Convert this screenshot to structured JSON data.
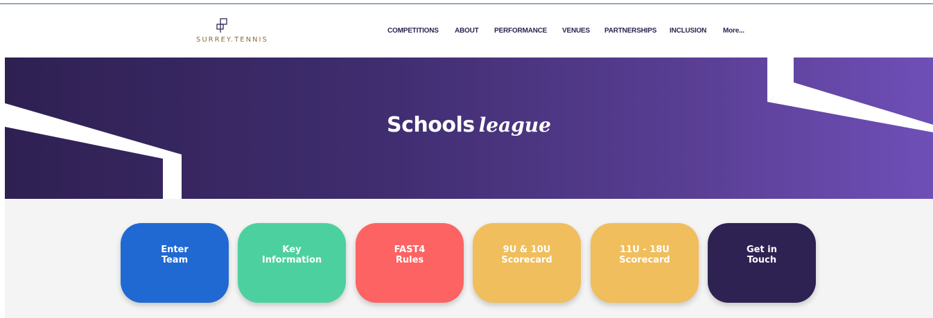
{
  "logo": {
    "text": "SURREY.TENNIS"
  },
  "nav": {
    "items": [
      {
        "label": "COMPETITIONS"
      },
      {
        "label": "ABOUT"
      },
      {
        "label": "PERFORMANCE"
      },
      {
        "label": "VENUES"
      },
      {
        "label": "PARTNERSHIPS"
      },
      {
        "label": "INCLUSION"
      },
      {
        "label": "More..."
      }
    ]
  },
  "hero": {
    "title_main": "Schools",
    "title_script": "league"
  },
  "tiles": [
    {
      "label": "Enter\nTeam",
      "color": "#2069d3"
    },
    {
      "label": "Key\nInformation",
      "color": "#4dd0a0"
    },
    {
      "label": "FAST4\nRules",
      "color": "#fd6363"
    },
    {
      "label": "9U & 10U\nScorecard",
      "color": "#f0be5c"
    },
    {
      "label": "11U - 18U\nScorecard",
      "color": "#f0be5c"
    },
    {
      "label": "Get in\nTouch",
      "color": "#2e2253"
    }
  ],
  "colors": {
    "nav_text": "#2a2550",
    "logo_text": "#8a6c3a",
    "hero_gradient_start": "#2f2052",
    "hero_gradient_end": "#6e4fb7"
  }
}
